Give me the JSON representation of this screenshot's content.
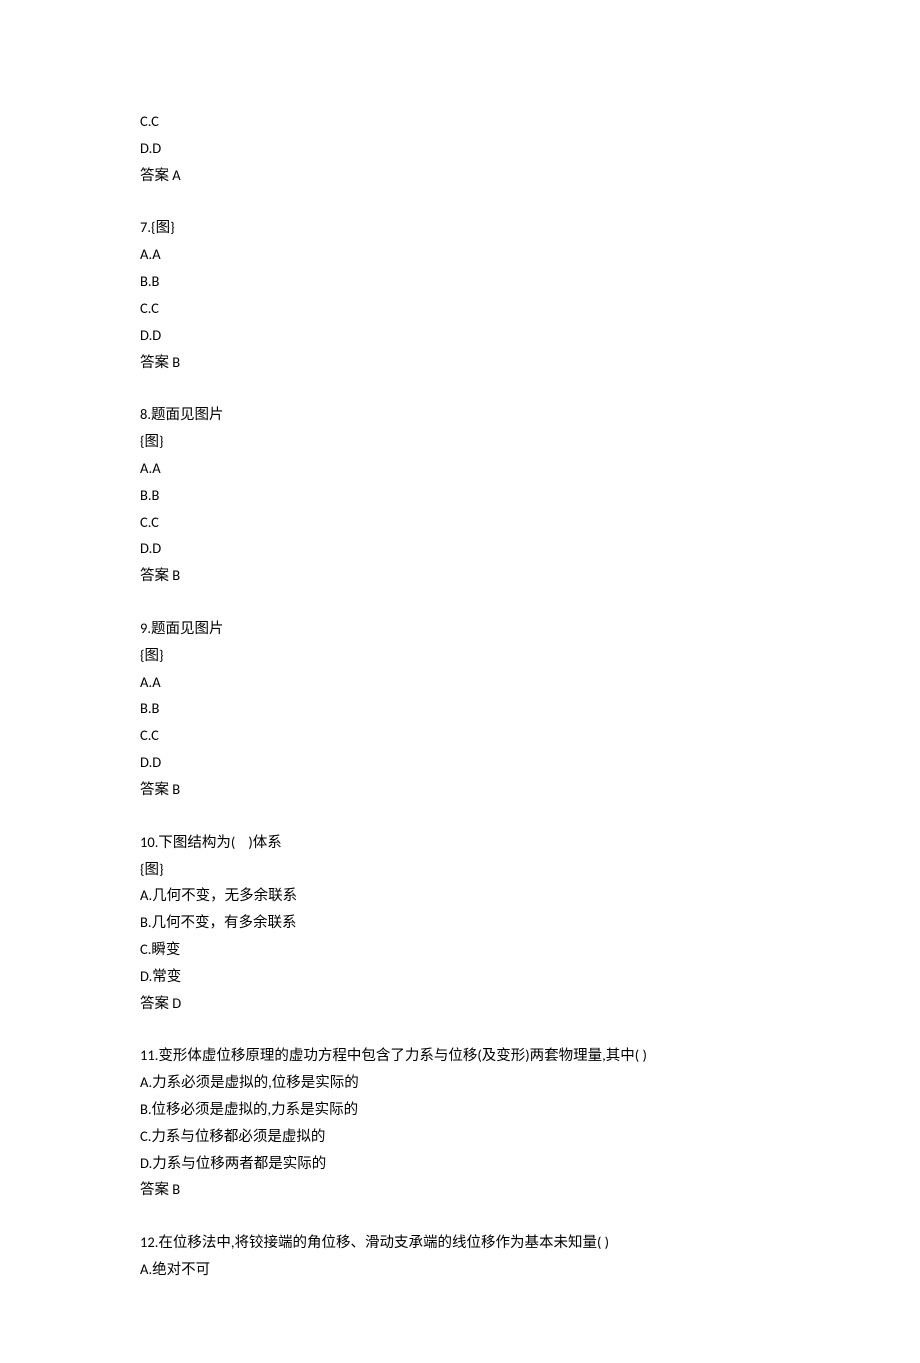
{
  "blocks": [
    {
      "lines": [
        "C.C",
        "D.D",
        "答案 A"
      ]
    },
    {
      "lines": [
        "7.{图}",
        "A.A",
        "B.B",
        "C.C",
        "D.D",
        "答案 B"
      ]
    },
    {
      "lines": [
        "8.题面见图片",
        "{图}",
        "A.A",
        "B.B",
        "C.C",
        "D.D",
        "答案 B"
      ]
    },
    {
      "lines": [
        "9.题面见图片",
        "{图}",
        "A.A",
        "B.B",
        "C.C",
        "D.D",
        "答案 B"
      ]
    },
    {
      "lines": [
        "10.下图结构为(    )体系",
        "{图}",
        "A.几何不变，无多余联系",
        "B.几何不变，有多余联系",
        "C.瞬变",
        "D.常变",
        "答案 D"
      ]
    },
    {
      "lines": [
        "11.变形体虚位移原理的虚功方程中包含了力系与位移(及变形)两套物理量,其中( )",
        "A.力系必须是虚拟的,位移是实际的",
        "B.位移必须是虚拟的,力系是实际的",
        "C.力系与位移都必须是虚拟的",
        "D.力系与位移两者都是实际的",
        "答案 B"
      ]
    },
    {
      "lines": [
        "12.在位移法中,将铰接端的角位移、滑动支承端的线位移作为基本未知量( )",
        "A.绝对不可"
      ]
    }
  ]
}
